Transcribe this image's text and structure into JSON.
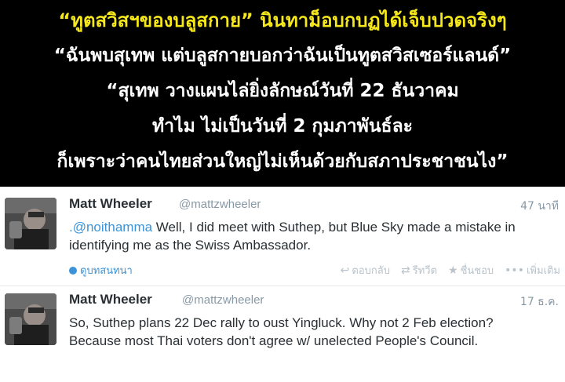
{
  "banner": {
    "lines": [
      "“ทูตสวิสฯของบลูสกาย” นินทาม็อบกบฏได้เจ็บปวดจริงๆ",
      "“ฉันพบสุเทพ แต่บลูสกายบอกว่าฉันเป็นทูตสวิสเซอร์แลนด์”",
      "“สุเทพ วางแผนไล่ยิ่งลักษณ์วันที่ 22 ธันวาคม",
      "ทำไม ไม่เป็นวันที่ 2 กุมภาพันธ์ละ",
      "ก็เพราะว่าคนไทยส่วนใหญ่ไม่เห็นด้วยกับสภาประชาชนไง”"
    ],
    "colors": {
      "headline": "#f6e81a",
      "text": "#ffffff",
      "background": "#000000"
    }
  },
  "tweets": [
    {
      "name": "Matt Wheeler",
      "handle": "@mattzwheeler",
      "time": "47 นาที",
      "mention": ".@noithamma",
      "text_after_mention": " Well, I did meet with Suthep, but Blue Sky made a mistake in identifying me as the Swiss Ambassador.",
      "conversation_label": "ดูบทสนทนา",
      "actions": {
        "reply": "ตอบกลับ",
        "retweet": "รีทวีต",
        "favorite": "ชื่นชอบ",
        "more": "เพิ่มเติม"
      }
    },
    {
      "name": "Matt Wheeler",
      "handle": "@mattzwheeler",
      "time": "17 ธ.ค.",
      "text": "So, Suthep plans 22 Dec rally to oust Yingluck. Why not 2 Feb election? Because most Thai voters don't agree w/ unelected People's Council."
    }
  ],
  "icons": {
    "conversation": "speech-bubble-icon",
    "reply": "reply-arrow-icon",
    "retweet": "retweet-icon",
    "favorite": "star-icon",
    "more": "ellipsis-icon"
  },
  "colors": {
    "link": "#3b94d9",
    "muted": "#8899a6",
    "action": "#b8c3cb",
    "text": "#292f33"
  }
}
